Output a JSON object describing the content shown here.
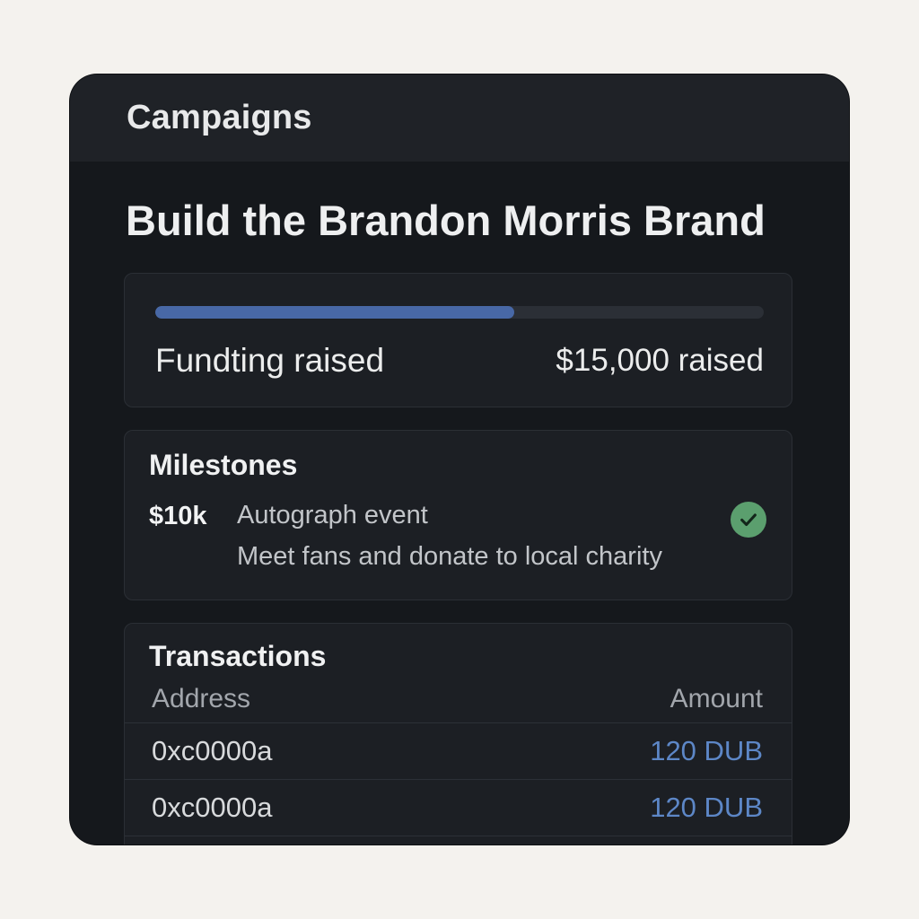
{
  "header": {
    "title": "Campaigns"
  },
  "campaign": {
    "title": "Build the Brandon Morris Brand"
  },
  "funding": {
    "label": "Fundting raised",
    "amount_text": "$15,000 raised",
    "progress": 0.59
  },
  "milestones": {
    "title": "Milestones",
    "items": [
      {
        "amount": "$10k",
        "name": "Autograph event",
        "description": "Meet fans and donate to local charity",
        "status_icon": "check-circle-icon",
        "completed": true
      }
    ]
  },
  "transactions": {
    "title": "Transactions",
    "columns": {
      "address": "Address",
      "amount": "Amount"
    },
    "rows": [
      {
        "address": "0xc0000a",
        "amount": "120 DUB"
      },
      {
        "address": "0xc0000a",
        "amount": "120 DUB"
      }
    ]
  },
  "colors": {
    "accent": "#4868a6",
    "amount_text": "#5d87c7",
    "success": "#5b9f6e"
  }
}
